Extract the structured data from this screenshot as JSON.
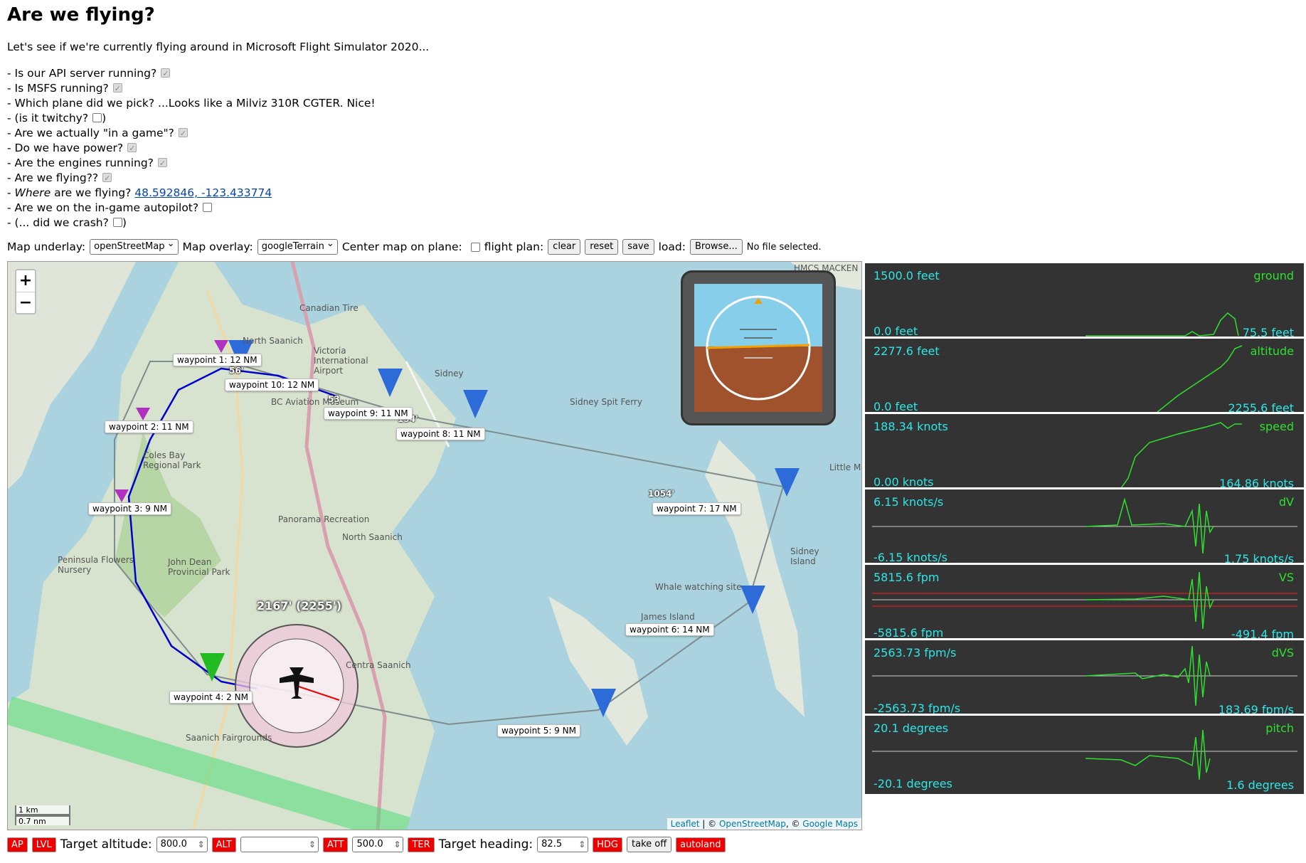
{
  "page": {
    "title": "Are we flying?",
    "intro": "Let's see if we're currently flying around in Microsoft Flight Simulator 2020...",
    "questions": [
      {
        "prefix": "- Is our API server running?",
        "checked": true
      },
      {
        "prefix": "- Is MSFS running?",
        "checked": true
      },
      {
        "prefix": "- Which plane did we pick? ...Looks like a Milviz 310R CGTER. Nice!"
      },
      {
        "prefix": "- (is it twitchy?",
        "suffix": ")",
        "checked": false
      },
      {
        "prefix": "- Are we actually \"in a game\"?",
        "checked": true
      },
      {
        "prefix": "- Do we have power?",
        "checked": true
      },
      {
        "prefix": "- Are the engines running?",
        "checked": true
      },
      {
        "prefix": "- Are we flying??",
        "checked": true
      },
      {
        "prefix": "- ",
        "em": "Where",
        "mid": " are we flying? ",
        "link": "48.592846, -123.433774"
      },
      {
        "prefix": "- Are we on the in-game autopilot?",
        "checked": false
      },
      {
        "prefix": "- (... did we crash?",
        "suffix": ")",
        "checked": false
      }
    ]
  },
  "controls": {
    "underlay_label": "Map underlay:",
    "underlay_value": "openStreetMap",
    "overlay_label": "Map overlay:",
    "overlay_value": "googleTerrain",
    "center_label": "Center map on plane:",
    "flightplan_label": "flight plan:",
    "clear": "clear",
    "reset": "reset",
    "save": "save",
    "load_label": "load:",
    "browse": "Browse...",
    "no_file": "No file selected."
  },
  "map": {
    "zoom_in": "+",
    "zoom_out": "−",
    "scale_km": "1 km",
    "scale_nm": "0.7 nm",
    "attribution": {
      "leaflet": "Leaflet",
      "sep1": " | © ",
      "osm": "OpenStreetMap",
      "sep2": ", © ",
      "google": "Google Maps"
    },
    "plane_label": "2167' (2255')",
    "waypoints": [
      {
        "label": "waypoint 1: 12 NM",
        "elev": "56'"
      },
      {
        "label": "waypoint 2: 11 NM"
      },
      {
        "label": "waypoint 3: 9 NM"
      },
      {
        "label": "waypoint 4: 2 NM"
      },
      {
        "label": "waypoint 5: 9 NM"
      },
      {
        "label": "waypoint 6: 14 NM"
      },
      {
        "label": "waypoint 7: 17 NM",
        "elev": "1054'"
      },
      {
        "label": "waypoint 8: 11 NM",
        "elev": "154'"
      },
      {
        "label": "waypoint 9: 11 NM",
        "elev": "53"
      },
      {
        "label": "waypoint 10: 12 NM"
      }
    ],
    "places": [
      "Canadian Tire",
      "North Saanich",
      "Victoria International Airport",
      "Sidney",
      "BC Aviation Museum",
      "Coles Bay Regional Park",
      "Panorama Recreation",
      "North Saanich",
      "John Dean Provincial Park",
      "Peninsula Flowers Nursery",
      "Whale watching site",
      "James Island",
      "Sidney Island",
      "Sidney Spit Ferry",
      "Little M",
      "HMCS MACKEN",
      "Saanich Fairgrounds",
      "Centra Saanich"
    ]
  },
  "graphs": [
    {
      "name": "ground",
      "max": "1500.0 feet",
      "min": "0.0 feet",
      "current": "75.5 feet"
    },
    {
      "name": "altitude",
      "max": "2277.6 feet",
      "min": "0.0 feet",
      "current": "2255.6 feet"
    },
    {
      "name": "speed",
      "max": "188.34 knots",
      "min": "0.00 knots",
      "current": "164.86 knots"
    },
    {
      "name": "dV",
      "max": "6.15 knots/s",
      "min": "-6.15 knots/s",
      "current": "1.75 knots/s"
    },
    {
      "name": "VS",
      "max": "5815.6 fpm",
      "min": "-5815.6 fpm",
      "current": "-491.4 fpm"
    },
    {
      "name": "dVS",
      "max": "2563.73 fpm/s",
      "min": "-2563.73 fpm/s",
      "current": "183.69 fpm/s"
    },
    {
      "name": "pitch",
      "max": "20.1 degrees",
      "min": "-20.1 degrees",
      "current": "1.6 degrees"
    }
  ],
  "autopilot": {
    "ap": "AP",
    "lvl": "LVL",
    "target_altitude_label": "Target altitude:",
    "target_altitude_value": "800.0",
    "alt": "ALT",
    "alt_value": "",
    "att": "ATT",
    "att_value": "500.0",
    "ter": "TER",
    "target_heading_label": "Target heading:",
    "target_heading_value": "82.5",
    "hdg": "HDG",
    "take_off": "take off",
    "autoland": "autoland"
  },
  "colors": {
    "graph_bg": "#333333",
    "graph_value": "#2ee6e6",
    "graph_line": "#2ee02e",
    "route": "#0000cc",
    "ap_button": "#ee0000"
  }
}
